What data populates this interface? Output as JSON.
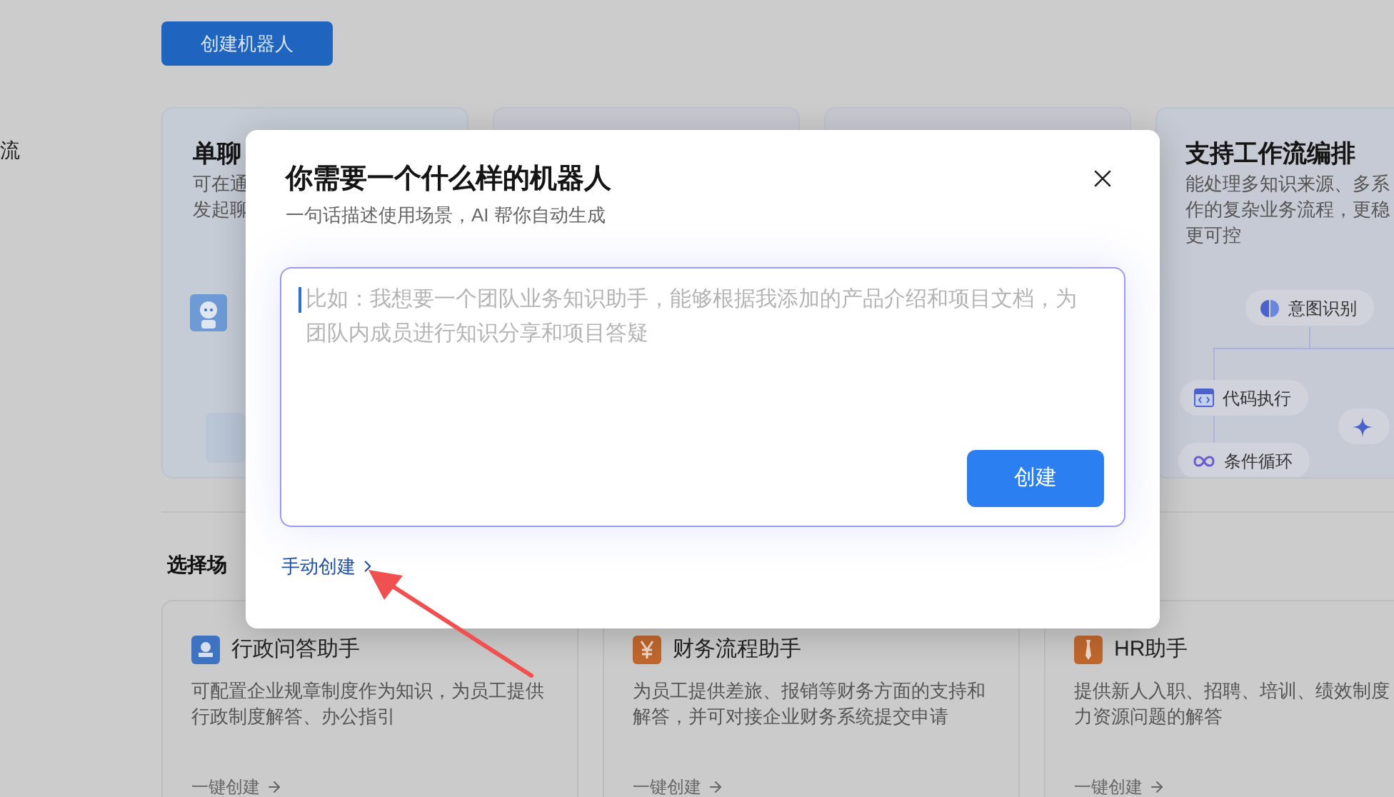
{
  "sidebar": {
    "item_fragment": "流"
  },
  "create_bot_button": "创建机器人",
  "feature_cards": [
    {
      "kind": "chat",
      "title": "单聊",
      "lines": [
        "可在通",
        "发起聊"
      ]
    },
    {
      "kind": "blank"
    },
    {
      "kind": "blank"
    },
    {
      "kind": "workflow",
      "title": "支持工作流编排",
      "lines": [
        "能处理多知识来源、多系",
        "作的复杂业务流程，更稳",
        "更可控"
      ],
      "nodes": [
        {
          "kind": "intent",
          "label": "意图识别"
        },
        {
          "kind": "code",
          "label": "代码执行"
        },
        {
          "kind": "model"
        },
        {
          "kind": "loop",
          "label": "条件循环"
        }
      ]
    }
  ],
  "section_title": "选择场",
  "scenarios": [
    {
      "kind": "admin",
      "title": "行政问答助手",
      "lines": [
        "可配置企业规章制度作为知识，为员工提供",
        "行政制度解答、办公指引"
      ],
      "action": "一键创建"
    },
    {
      "kind": "finance",
      "title": "财务流程助手",
      "lines": [
        "为员工提供差旅、报销等财务方面的支持和",
        "解答，并可对接企业财务系统提交申请"
      ],
      "action": "一键创建"
    },
    {
      "kind": "hr",
      "title": "HR助手",
      "lines": [
        "提供新人入职、招聘、培训、绩效制度",
        "力资源问题的解答"
      ],
      "action": "一键创建"
    }
  ],
  "dialog": {
    "title": "你需要一个什么样的机器人",
    "subtitle": "一句话描述使用场景，AI 帮你自动生成",
    "prompt": {
      "placeholder": "比如：我想要一个团队业务知识助手，能够根据我添加的产品介绍和项目文档，为团队内成员进行知识分享和项目答疑"
    },
    "submit": "创建",
    "manual_link": "手动创建"
  }
}
